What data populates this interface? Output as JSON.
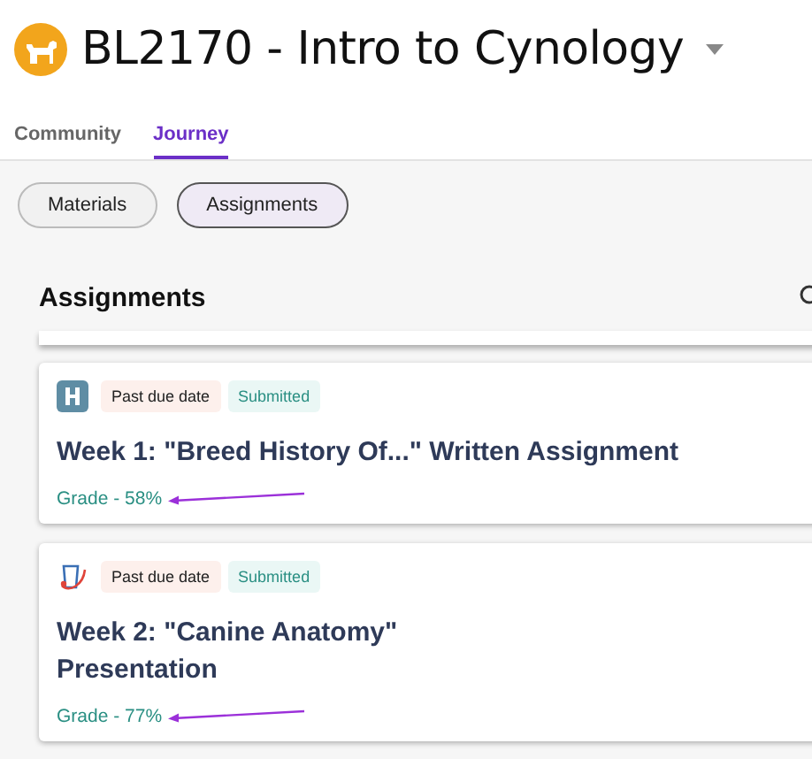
{
  "course": {
    "title": "BL2170 - Intro to Cynology"
  },
  "tabs": [
    {
      "label": "Community",
      "selected": false
    },
    {
      "label": "Journey",
      "selected": true
    }
  ],
  "filters": [
    {
      "label": "Materials",
      "selected": false
    },
    {
      "label": "Assignments",
      "selected": true
    }
  ],
  "section": {
    "title": "Assignments"
  },
  "assignments": [
    {
      "kind": "h-badge",
      "tags": [
        {
          "label": "Past due date",
          "kind": "due"
        },
        {
          "label": "Submitted",
          "kind": "status"
        }
      ],
      "title": "Week 1: \"Breed History Of...\" Written Assignment",
      "grade": "Grade - 58%"
    },
    {
      "kind": "presentation",
      "tags": [
        {
          "label": "Past due date",
          "kind": "due"
        },
        {
          "label": "Submitted",
          "kind": "status"
        }
      ],
      "title": "Week 2: \"Canine Anatomy\"\nPresentation",
      "grade": "Grade - 77%"
    }
  ]
}
